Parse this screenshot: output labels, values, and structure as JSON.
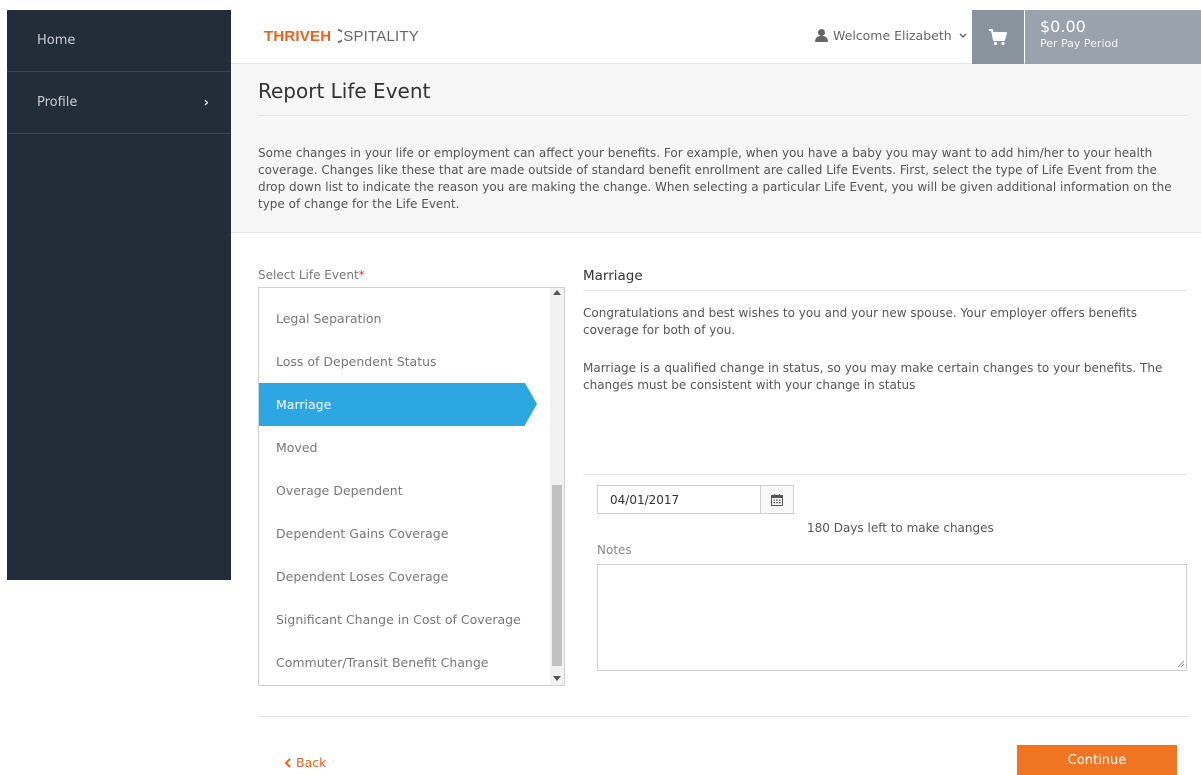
{
  "sidebar": {
    "items": [
      {
        "label": "Home"
      },
      {
        "label": "Profile",
        "chevron": "›"
      }
    ]
  },
  "header": {
    "logo_part1": "THRIVEH",
    "logo_part2": "SPITALITY",
    "welcome": "Welcome Elizabeth",
    "cart_icon": "shopping-cart-icon",
    "amount": "$0.00",
    "period": "Per Pay Period"
  },
  "page": {
    "title": "Report Life Event",
    "description": "Some changes in your life or employment can affect your benefits. For example, when you have a baby you may want to add him/her to your health coverage. Changes like these that are made outside of standard benefit enrollment are called Life Events. First, select the type of Life Event from the drop down list to indicate the reason you are making the change. When selecting a particular Life Event, you will be given additional information on the type of change for the Life Event."
  },
  "select": {
    "label": "Select Life Event",
    "required_mark": "*",
    "items": [
      {
        "label": "Legal Separation"
      },
      {
        "label": "Loss of Dependent Status"
      },
      {
        "label": "Marriage",
        "selected": true
      },
      {
        "label": "Moved"
      },
      {
        "label": "Overage Dependent"
      },
      {
        "label": "Dependent Gains Coverage"
      },
      {
        "label": "Dependent Loses Coverage"
      },
      {
        "label": "Significant Change in Cost of Coverage"
      },
      {
        "label": "Commuter/Transit Benefit Change"
      }
    ]
  },
  "detail": {
    "title": "Marriage",
    "p1": "Congratulations and best wishes to you and your new spouse. Your employer offers benefits coverage for both of you.",
    "p2": "Marriage is a qualified change in status, so you may make certain changes to your benefits. The changes must be consistent with your change in status",
    "date_value": "04/01/2017",
    "days_left": "180 Days left to make changes",
    "notes_label": "Notes",
    "notes_value": ""
  },
  "footer": {
    "back_label": "Back",
    "continue_label": "Continue"
  },
  "colors": {
    "accent_orange": "#f07523",
    "selected_blue": "#2da7e2",
    "sidebar_bg": "#232c39"
  }
}
